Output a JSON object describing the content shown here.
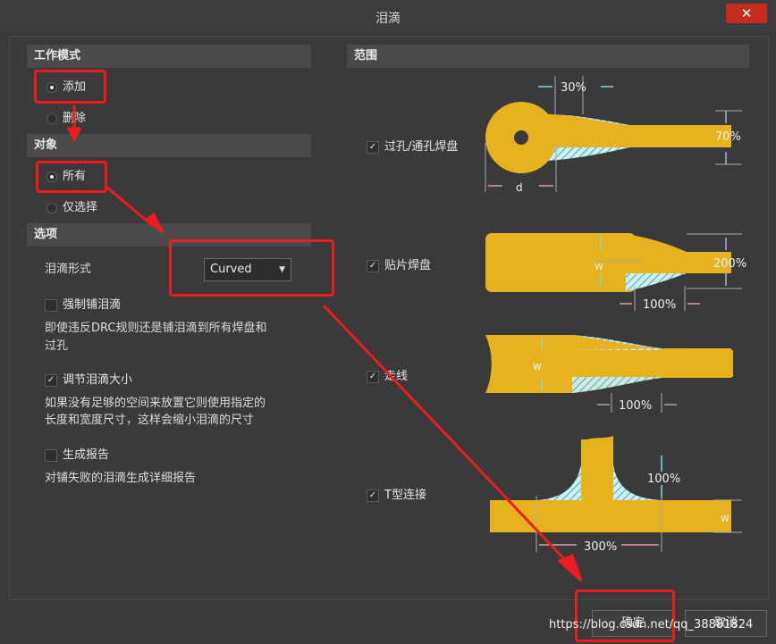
{
  "window": {
    "title": "泪滴",
    "close_glyph": "✕"
  },
  "mode": {
    "header": "工作模式",
    "add": "添加",
    "delete": "删除"
  },
  "target": {
    "header": "对象",
    "all": "所有",
    "selected": "仅选择"
  },
  "options": {
    "header": "选项",
    "shape_label": "泪滴形式",
    "shape_value": "Curved",
    "force_label": "强制铺泪滴",
    "force_desc_line1": "即使违反DRC规则还是铺泪滴到所有焊盘和",
    "force_desc_line2": "过孔",
    "adjust_label": "调节泪滴大小",
    "adjust_desc_line1": "如果没有足够的空间来放置它则使用指定的",
    "adjust_desc_line2": "长度和宽度尺寸，这样会缩小泪滴的尺寸",
    "report_label": "生成报告",
    "report_desc": "对铺失败的泪滴生成详细报告"
  },
  "scope": {
    "header": "范围",
    "items": [
      {
        "label": "过孔/通孔焊盘"
      },
      {
        "label": "贴片焊盘"
      },
      {
        "label": "走线"
      },
      {
        "label": "T型连接"
      }
    ],
    "dims": {
      "via_length": "30%",
      "via_width": "70%",
      "via_d": "d",
      "smd_width": "200%",
      "smd_length": "100%",
      "smd_w": "w",
      "track_w": "w",
      "track_length": "100%",
      "t_length": "100%",
      "t_w": "w",
      "t_width": "300%"
    }
  },
  "footer": {
    "ok": "确定",
    "cancel": "取消"
  },
  "watermark": "https://blog.csdn.net/qq_38881824",
  "colors": {
    "copper": "#e6b31f",
    "hatch": "#7fd8e8",
    "annot": "#ee1c1c"
  }
}
